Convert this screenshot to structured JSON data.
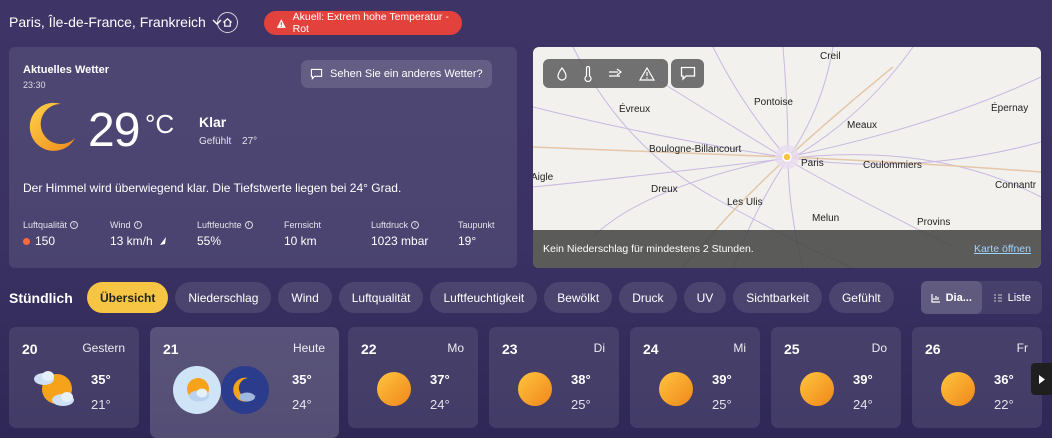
{
  "header": {
    "location": "Paris, Île-de-France, Frankreich",
    "alert": "Akuell: Extrem hohe Temperatur - Rot"
  },
  "current": {
    "title": "Aktuelles Wetter",
    "time": "23:30",
    "other_weather": "Sehen Sie ein anderes Wetter?",
    "temp": "29",
    "unit": "°C",
    "condition": "Klar",
    "felt_label": "Gefühlt",
    "felt_value": "27°",
    "description": "Der Himmel wird überwiegend klar. Die Tiefstwerte liegen bei 24° Grad.",
    "stats": [
      {
        "label": "Luftqualität",
        "value": "150"
      },
      {
        "label": "Wind",
        "value": "13 km/h"
      },
      {
        "label": "Luftfeuchte",
        "value": "55%"
      },
      {
        "label": "Fernsicht",
        "value": "10 km"
      },
      {
        "label": "Luftdruck",
        "value": "1023 mbar"
      },
      {
        "label": "Taupunkt",
        "value": "19°"
      }
    ]
  },
  "map": {
    "cities": [
      "Creil",
      "Évreux",
      "Pontoise",
      "Épernay",
      "Meaux",
      "Boulogne-Billancourt",
      "Paris",
      "Coulommiers",
      "Aigle",
      "Dreux",
      "Connantr",
      "Les Ulis",
      "Melun",
      "Provins"
    ],
    "footer_text": "Kein Niederschlag für mindestens 2 Stunden.",
    "open_map": "Karte öffnen"
  },
  "hourly": {
    "title": "Stündlich",
    "chips": [
      "Übersicht",
      "Niederschlag",
      "Wind",
      "Luftqualität",
      "Luftfeuchtigkeit",
      "Bewölkt",
      "Druck",
      "UV",
      "Sichtbarkeit",
      "Gefühlt"
    ],
    "view_diagram": "Dia...",
    "view_list": "Liste"
  },
  "days": [
    {
      "num": "20",
      "name": "Gestern",
      "hi": "35°",
      "lo": "21°"
    },
    {
      "num": "21",
      "name": "Heute",
      "hi": "35°",
      "lo": "24°"
    },
    {
      "num": "22",
      "name": "Mo",
      "hi": "37°",
      "lo": "24°"
    },
    {
      "num": "23",
      "name": "Di",
      "hi": "38°",
      "lo": "25°"
    },
    {
      "num": "24",
      "name": "Mi",
      "hi": "39°",
      "lo": "25°"
    },
    {
      "num": "25",
      "name": "Do",
      "hi": "39°",
      "lo": "24°"
    },
    {
      "num": "26",
      "name": "Fr",
      "hi": "36°",
      "lo": "22°"
    }
  ],
  "colors": {
    "alert": "#e3413c",
    "active_chip": "#f6c544",
    "sun": "#f7a21b"
  }
}
